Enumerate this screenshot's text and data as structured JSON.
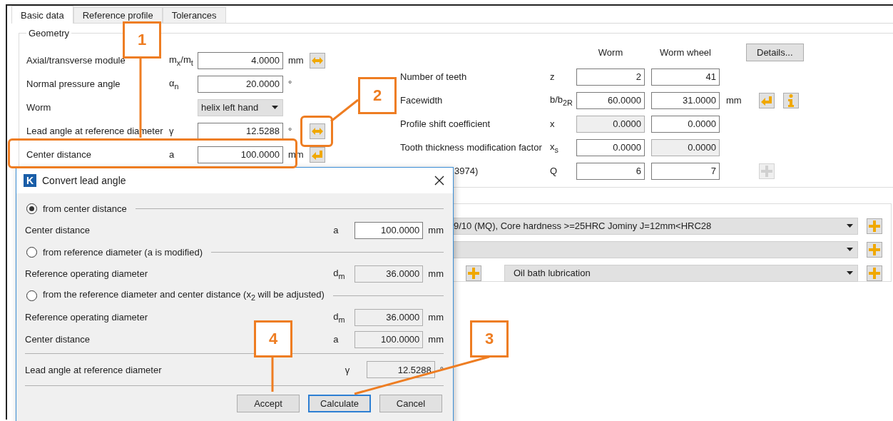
{
  "tabs": [
    {
      "label": "Basic data",
      "selected": true
    },
    {
      "label": "Reference profile",
      "selected": false
    },
    {
      "label": "Tolerances",
      "selected": false
    }
  ],
  "geometry": {
    "title": "Geometry",
    "left_rows": [
      {
        "label": "Axial/transverse module",
        "symbol": "m$_{x}$/m$_{t}$",
        "kind": "input",
        "value": "4.0000",
        "unit": "mm",
        "button": {
          "kind": "swap"
        }
      },
      {
        "label": "Normal pressure angle",
        "symbol": "α$_{n}$",
        "kind": "input",
        "value": "20.0000",
        "unit": "°"
      },
      {
        "label": "Worm",
        "kind": "dropdown",
        "value": "helix left hand"
      },
      {
        "label": "Lead angle at reference diameter",
        "symbol": "γ",
        "kind": "input",
        "value": "12.5288",
        "unit": "°",
        "button": {
          "kind": "swap"
        }
      },
      {
        "label": "Center distance",
        "symbol": "a",
        "kind": "input",
        "value": "100.0000",
        "unit": "mm",
        "button": {
          "kind": "apply"
        }
      }
    ],
    "headers": [
      "Worm",
      "Worm wheel"
    ],
    "details_button": "Details...",
    "right_rows": [
      {
        "label": "Number of teeth",
        "symbol": "z",
        "values": [
          {
            "value": "2",
            "readonly": false
          },
          {
            "value": "41",
            "readonly": false
          }
        ]
      },
      {
        "label": "Facewidth",
        "symbol": "b/b$_{2R}$",
        "values": [
          {
            "value": "60.0000",
            "readonly": false
          },
          {
            "value": "31.0000",
            "readonly": false
          }
        ],
        "unit": "mm",
        "buttons": [
          {
            "kind": "apply"
          },
          {
            "kind": "info"
          }
        ]
      },
      {
        "label": "Profile shift coefficient",
        "symbol": "x",
        "values": [
          {
            "value": "0.0000",
            "readonly": true
          },
          {
            "value": "0.0000",
            "readonly": false
          }
        ]
      },
      {
        "label": "Tooth thickness modification factor",
        "symbol": "x$_{s}$",
        "values": [
          {
            "value": "0.0000",
            "readonly": false
          },
          {
            "value": "0.0000",
            "readonly": true
          }
        ]
      },
      {
        "label": "3974)",
        "symbol": "Q",
        "values": [
          {
            "value": "6",
            "readonly": false
          },
          {
            "value": "7",
            "readonly": false
          }
        ],
        "buttons": [
          {
            "kind": "plus_disabled"
          }
        ]
      }
    ]
  },
  "materials": [
    {
      "value": "9/10 (MQ), Core hardness >=25HRC Jominy J=12mm<HRC28",
      "kind": "wide"
    },
    {
      "kind": "wide"
    },
    {
      "value": "Oil bath lubrication",
      "kind": "short"
    }
  ],
  "dialog": {
    "icon_letter": "K",
    "title": "Convert lead angle",
    "sections": [
      {
        "option": "from center distance",
        "selected": true,
        "rows": [
          {
            "label": "Center distance",
            "symbol": "a",
            "value": "100.0000",
            "unit": "mm",
            "readonly": false
          }
        ]
      },
      {
        "option": "from reference diameter (a is modified)",
        "selected": false,
        "rows": [
          {
            "label": "Reference operating diameter",
            "symbol": "d$_{m}$",
            "value": "36.0000",
            "unit": "mm",
            "readonly": true
          }
        ]
      },
      {
        "option": "from the reference diameter and center distance (x$_{2}$ will be adjusted)",
        "selected": false,
        "rows": [
          {
            "label": "Reference operating diameter",
            "symbol": "d$_{m}$",
            "value": "36.0000",
            "unit": "mm",
            "readonly": true
          },
          {
            "label": "Center distance",
            "symbol": "a",
            "value": "100.0000",
            "unit": "mm",
            "readonly": true
          }
        ]
      }
    ],
    "result": {
      "label": "Lead angle at reference diameter",
      "symbol": "γ",
      "value": "12.5288",
      "unit": "°",
      "readonly": true
    },
    "buttons": [
      {
        "label": "Accept",
        "focused": false
      },
      {
        "label": "Calculate",
        "focused": true
      },
      {
        "label": "Cancel",
        "focused": false
      }
    ]
  },
  "callouts": [
    {
      "label": "1"
    },
    {
      "label": "2"
    },
    {
      "label": "3"
    },
    {
      "label": "4"
    }
  ]
}
